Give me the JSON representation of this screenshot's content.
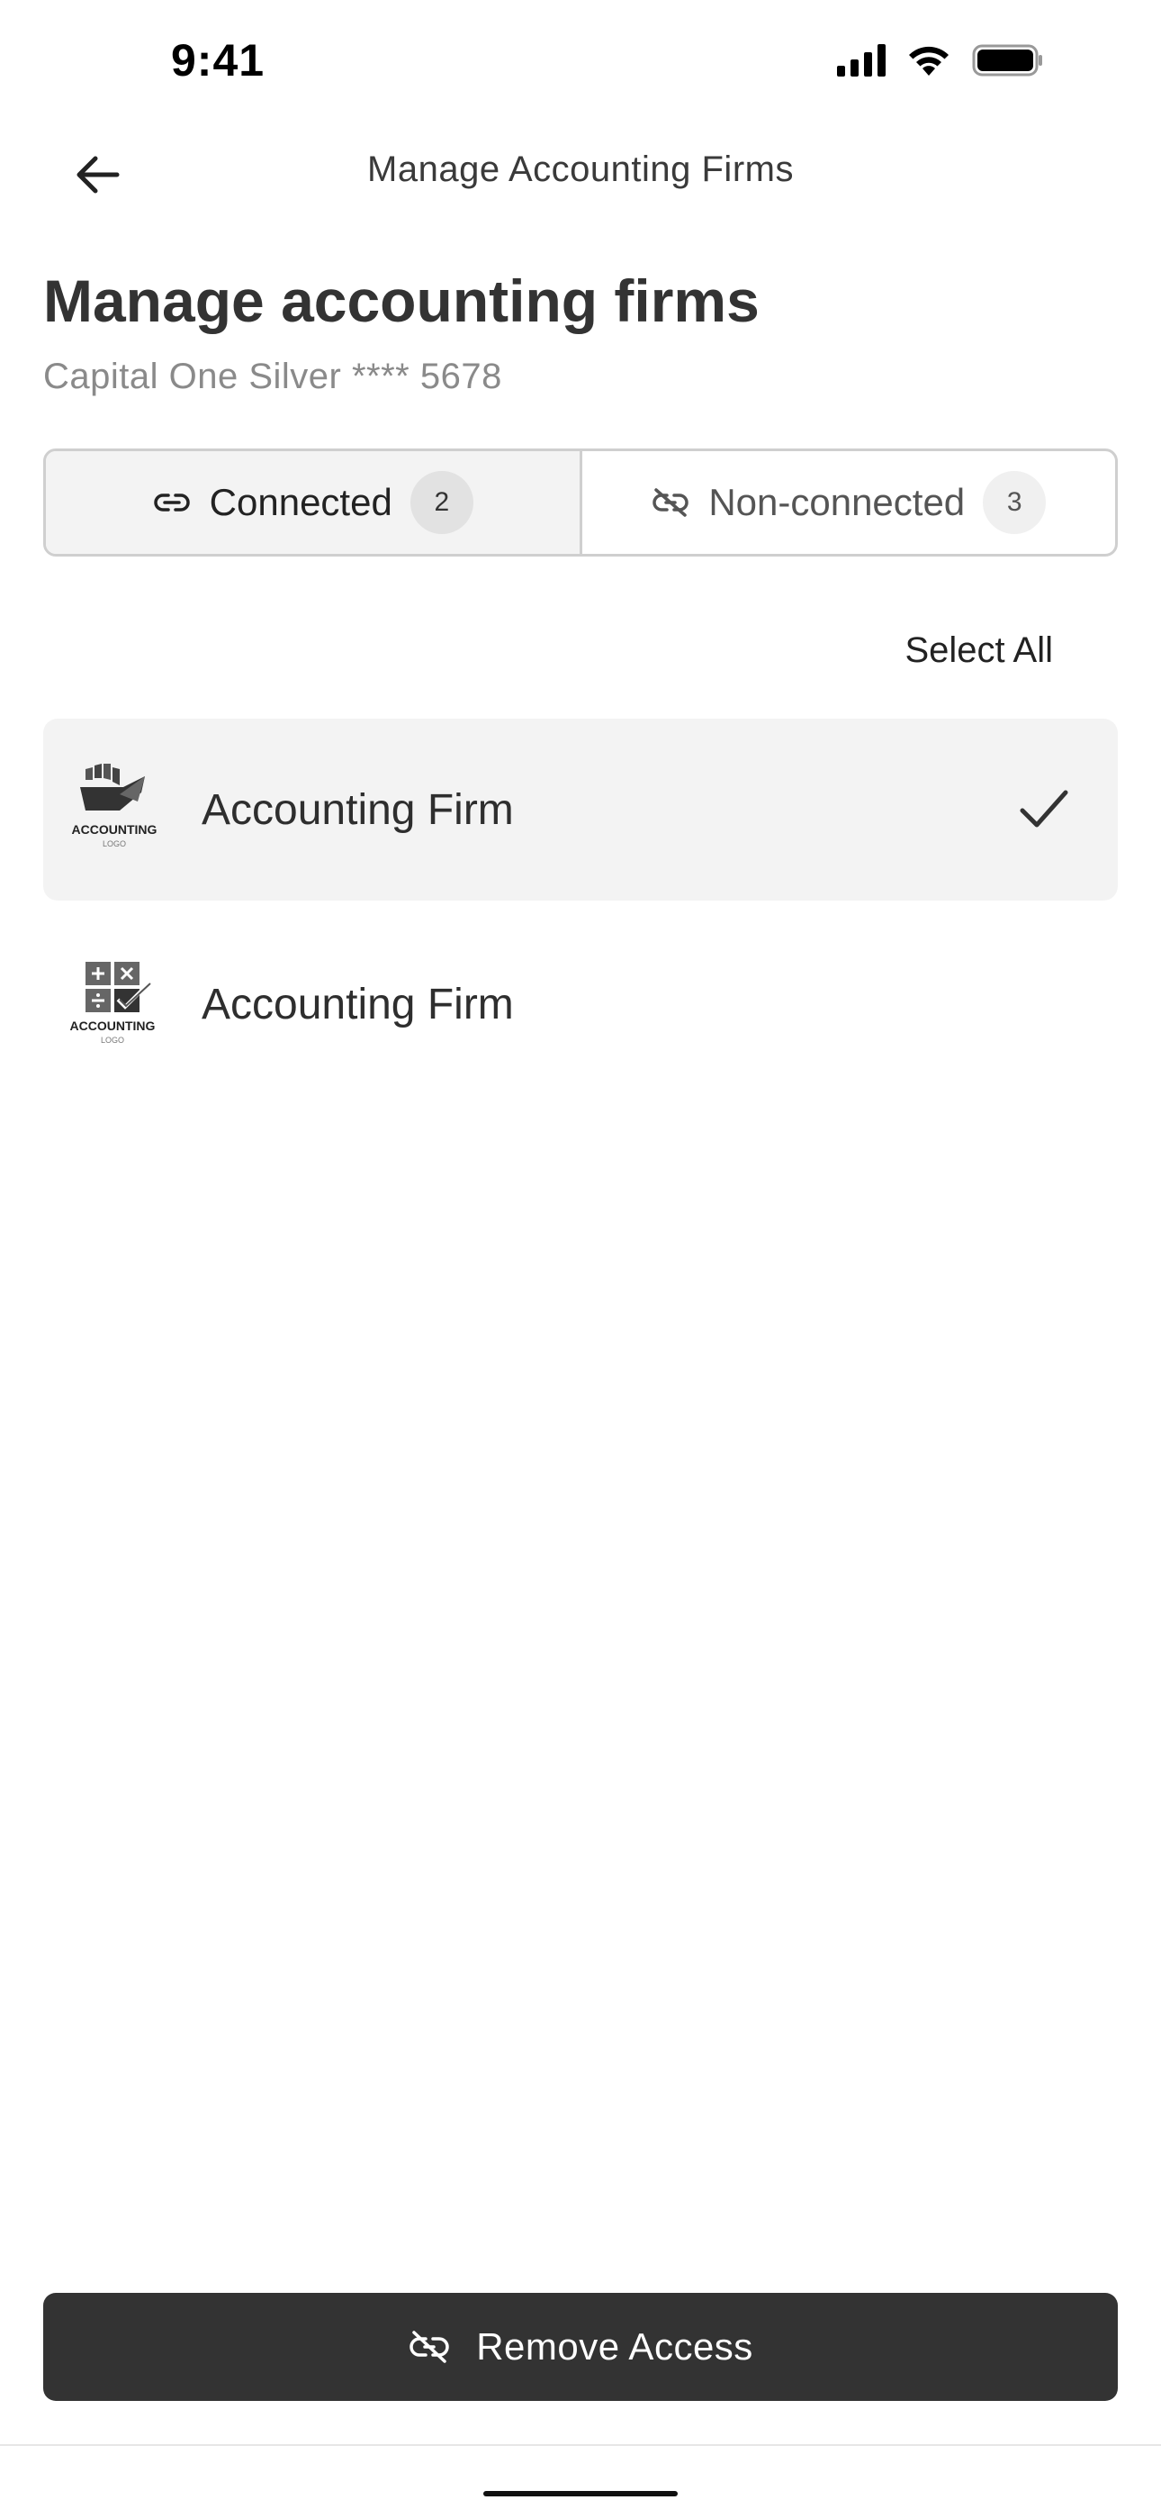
{
  "status_bar": {
    "time": "9:41"
  },
  "nav": {
    "title": "Manage Accounting Firms"
  },
  "header": {
    "title": "Manage accounting firms",
    "subtitle": "Capital One Silver **** 5678"
  },
  "tabs": [
    {
      "label": "Connected",
      "count": "2",
      "active": true,
      "icon": "link-icon"
    },
    {
      "label": "Non-connected",
      "count": "3",
      "active": false,
      "icon": "link-off-icon"
    }
  ],
  "list": {
    "select_all_label": "Select All",
    "items": [
      {
        "name": "Accounting Firm",
        "selected": true,
        "logo": "accounting-logo-hand",
        "logo_text": "ACCOUNTING",
        "logo_subtext": "LOGO"
      },
      {
        "name": "Accounting Firm",
        "selected": false,
        "logo": "accounting-logo-calculator",
        "logo_text": "ACCOUNTING",
        "logo_subtext": "LOGO"
      }
    ]
  },
  "footer": {
    "remove_button_label": "Remove Access",
    "remove_button_icon": "link-off-icon"
  },
  "colors": {
    "primary_button": "#333333",
    "selected_row": "#f3f3f3",
    "border": "#cfcfcf",
    "subtitle": "#8a8a8a"
  }
}
